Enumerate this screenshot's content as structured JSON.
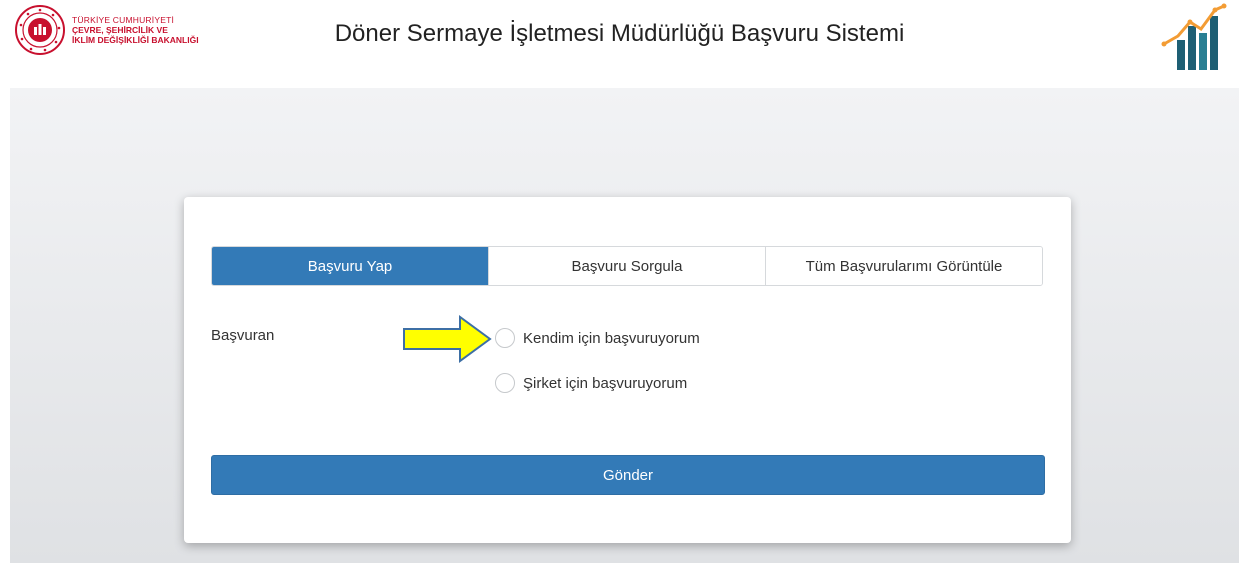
{
  "header": {
    "ministry_lines": [
      "TÜRKİYE CUMHURİYETİ",
      "ÇEVRE, ŞEHİRCİLİK VE",
      "İKLİM DEĞİŞİKLİĞİ BAKANLIĞI"
    ],
    "title": "Döner Sermaye İşletmesi Müdürlüğü Başvuru Sistemi",
    "emblem_icon": "ministry-emblem-icon",
    "brand_icon": "bar-chart-growth-icon"
  },
  "tabs": [
    {
      "label": "Başvuru Yap",
      "active": true
    },
    {
      "label": "Başvuru Sorgula",
      "active": false
    },
    {
      "label": "Tüm Başvurularımı Görüntüle",
      "active": false
    }
  ],
  "form": {
    "applicant_label": "Başvuran",
    "options": [
      {
        "label": "Kendim için başvuruyorum",
        "selected": false
      },
      {
        "label": "Şirket için başvuruyorum",
        "selected": false
      }
    ],
    "submit_label": "Gönder"
  },
  "colors": {
    "primary": "#337ab7",
    "ministry_red": "#c8102e",
    "arrow_fill": "#ffff00",
    "arrow_stroke": "#3d6fa5",
    "brand_orange": "#f39c34",
    "brand_teal": "#1e5f74"
  }
}
